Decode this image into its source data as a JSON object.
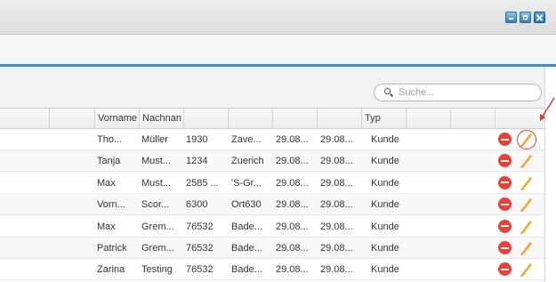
{
  "colors": {
    "accent": "#3a8ad6",
    "delete": "#e8413a",
    "edit": "#f5a623"
  },
  "window": {
    "buttons": [
      {
        "name": "minimize",
        "icon": "minimize-icon"
      },
      {
        "name": "maximize",
        "icon": "maximize-icon"
      },
      {
        "name": "close",
        "icon": "close-icon"
      }
    ]
  },
  "search": {
    "placeholder": "Suche...",
    "value": "",
    "icon": "search-icon"
  },
  "table": {
    "columns": [
      "",
      "",
      "Vorname",
      "Nachnan",
      "",
      "",
      "",
      "",
      "Typ",
      "",
      ""
    ],
    "rows": [
      {
        "vorname": "Tho...",
        "nachname": "Müller",
        "plz": "1930",
        "ort": "Zave...",
        "date1": "29.08...",
        "date2": "29.08...",
        "typ": "Kunde"
      },
      {
        "vorname": "Tanja",
        "nachname": "Must...",
        "plz": "1234",
        "ort": "Zuerich",
        "date1": "29.08...",
        "date2": "29.08...",
        "typ": "Kunde"
      },
      {
        "vorname": "Max",
        "nachname": "Must...",
        "plz": "2585 ...",
        "ort": "'S-Gr...",
        "date1": "29.08...",
        "date2": "29.08...",
        "typ": "Kunde"
      },
      {
        "vorname": "Vorn...",
        "nachname": "Scor...",
        "plz": "6300",
        "ort": "Ort630",
        "date1": "29.08...",
        "date2": "29.08...",
        "typ": "Kunde"
      },
      {
        "vorname": "Max",
        "nachname": "Grem...",
        "plz": "76532",
        "ort": "Bade...",
        "date1": "29.08...",
        "date2": "29.08...",
        "typ": "Kunde"
      },
      {
        "vorname": "Patrick",
        "nachname": "Grem...",
        "plz": "76532",
        "ort": "Bade...",
        "date1": "29.08...",
        "date2": "29.08...",
        "typ": "Kunde"
      },
      {
        "vorname": "Zarina",
        "nachname": "Testing",
        "plz": "76532",
        "ort": "Bade...",
        "date1": "29.08...",
        "date2": "29.08...",
        "typ": "Kunde"
      }
    ]
  }
}
